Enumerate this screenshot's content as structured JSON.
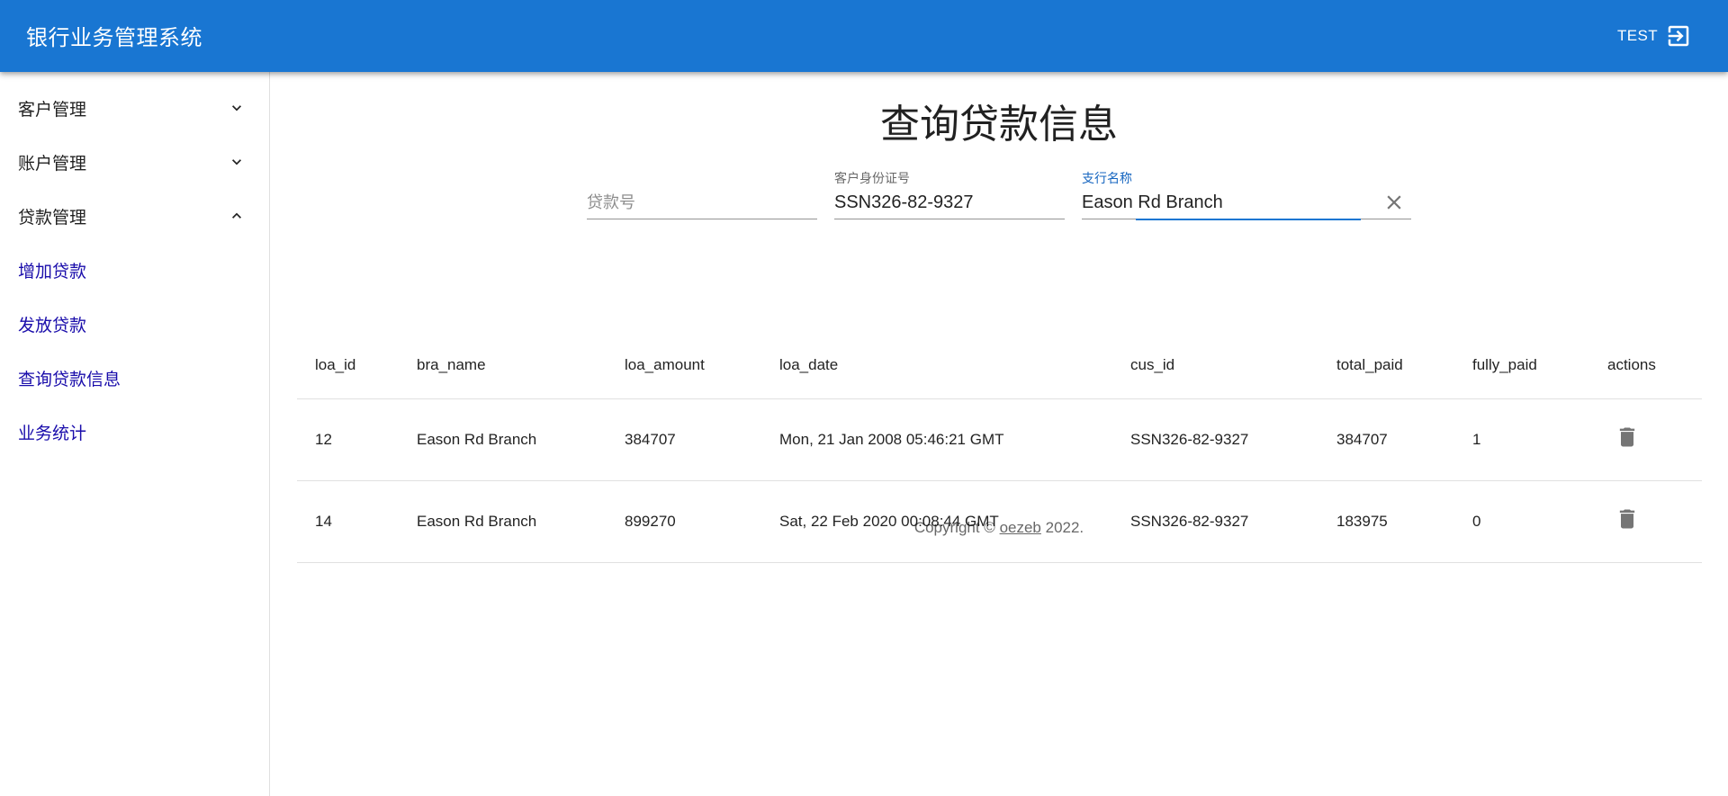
{
  "app": {
    "title": "银行业务管理系统",
    "user": "TEST"
  },
  "colors": {
    "primary": "#1976d2",
    "link": "#1a0dab"
  },
  "sidebar": {
    "groups": [
      {
        "label": "客户管理",
        "expanded": false,
        "icon": "chevron-down-icon"
      },
      {
        "label": "账户管理",
        "expanded": false,
        "icon": "chevron-down-icon"
      },
      {
        "label": "贷款管理",
        "expanded": true,
        "icon": "chevron-up-icon"
      }
    ],
    "sub_items": [
      {
        "label": "增加贷款"
      },
      {
        "label": "发放贷款"
      },
      {
        "label": "查询贷款信息"
      },
      {
        "label": "业务统计"
      }
    ]
  },
  "main": {
    "title": "查询贷款信息",
    "filters": {
      "loan_no": {
        "placeholder": "贷款号",
        "value": ""
      },
      "customer_id": {
        "label": "客户身份证号",
        "value": "SSN326-82-9327"
      },
      "branch_name": {
        "label": "支行名称",
        "value": "Eason Rd Branch"
      }
    },
    "table": {
      "columns": [
        "loa_id",
        "bra_name",
        "loa_amount",
        "loa_date",
        "cus_id",
        "total_paid",
        "fully_paid",
        "actions"
      ],
      "rows": [
        {
          "loa_id": "12",
          "bra_name": "Eason Rd Branch",
          "loa_amount": "384707",
          "loa_date": "Mon, 21 Jan 2008 05:46:21 GMT",
          "cus_id": "SSN326-82-9327",
          "total_paid": "384707",
          "fully_paid": "1"
        },
        {
          "loa_id": "14",
          "bra_name": "Eason Rd Branch",
          "loa_amount": "899270",
          "loa_date": "Sat, 22 Feb 2020 00:08:44 GMT",
          "cus_id": "SSN326-82-9327",
          "total_paid": "183975",
          "fully_paid": "0"
        }
      ]
    },
    "footer": {
      "prefix": "Copyright © ",
      "link": "oezeb",
      "suffix": " 2022."
    }
  }
}
